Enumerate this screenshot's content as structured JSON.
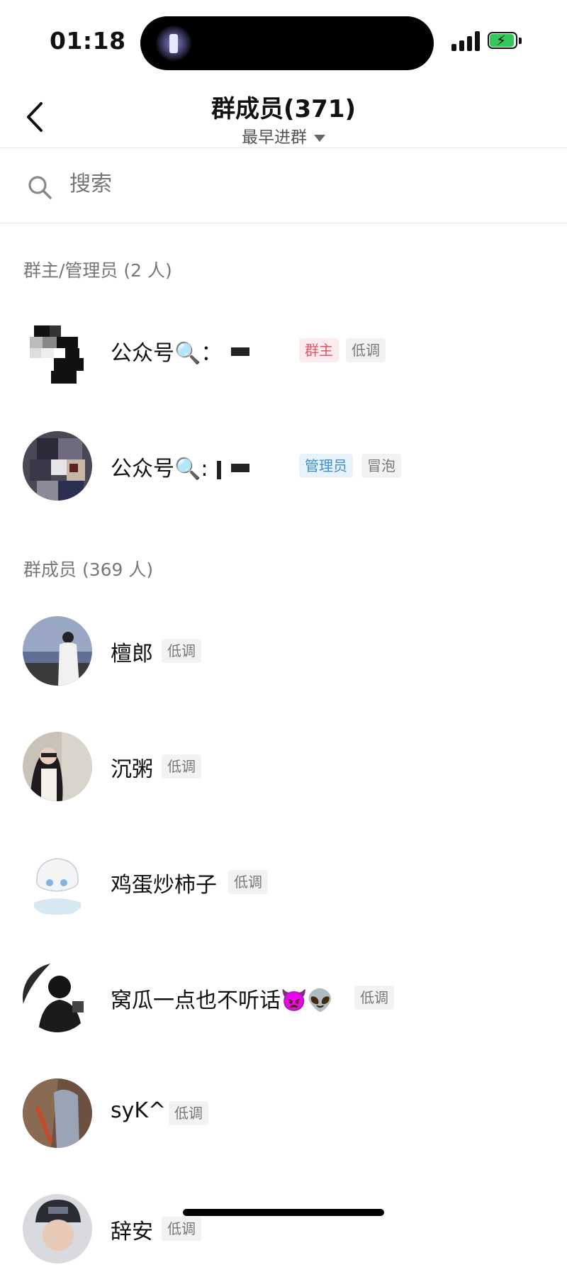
{
  "status": {
    "time": "01:18"
  },
  "header": {
    "title": "群成员(371)",
    "sort_label": "最早进群"
  },
  "search": {
    "placeholder": "搜索"
  },
  "sections": {
    "admins_label": "群主/管理员 (2 人)",
    "members_label": "群成员 (369 人)"
  },
  "admins": [
    {
      "name": "公众号🔍：",
      "role_tag": "群主",
      "status_tag": "低调"
    },
    {
      "name": "公众号🔍:",
      "role_tag": "管理员",
      "status_tag": "冒泡"
    }
  ],
  "members": [
    {
      "name": "檀郎",
      "tag": "低调"
    },
    {
      "name": "沉粥",
      "tag": "低调"
    },
    {
      "name": "鸡蛋炒柿子",
      "tag": "低调"
    },
    {
      "name": "窝瓜一点也不听话👿👽",
      "tag": "低调"
    },
    {
      "name": "syK^",
      "tag": "低调"
    },
    {
      "name": "辞安",
      "tag": "低调"
    }
  ],
  "colors": {
    "owner_tag": "#e0556a",
    "admin_tag": "#3b8fd6",
    "battery": "#34c759"
  }
}
